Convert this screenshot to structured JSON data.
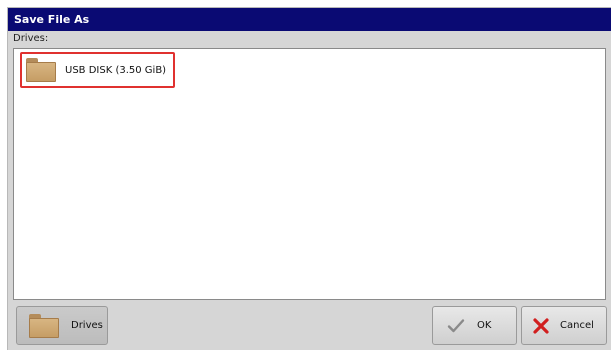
{
  "dialog": {
    "title": "Save File As",
    "drives_label": "Drives:",
    "colors": {
      "titlebar": "#0a0a73",
      "selection_outline": "#e0312f",
      "dialog_bg": "#d6d6d6"
    }
  },
  "drive_list": {
    "items": [
      {
        "label": "USB DISK (3.50 GiB)",
        "icon": "folder-icon",
        "selected": true
      }
    ]
  },
  "buttons": {
    "drives_label": "Drives",
    "drives_icon": "folder-icon",
    "ok_label": "OK",
    "ok_icon": "checkmark-icon",
    "cancel_label": "Cancel",
    "cancel_icon": "x-icon"
  }
}
